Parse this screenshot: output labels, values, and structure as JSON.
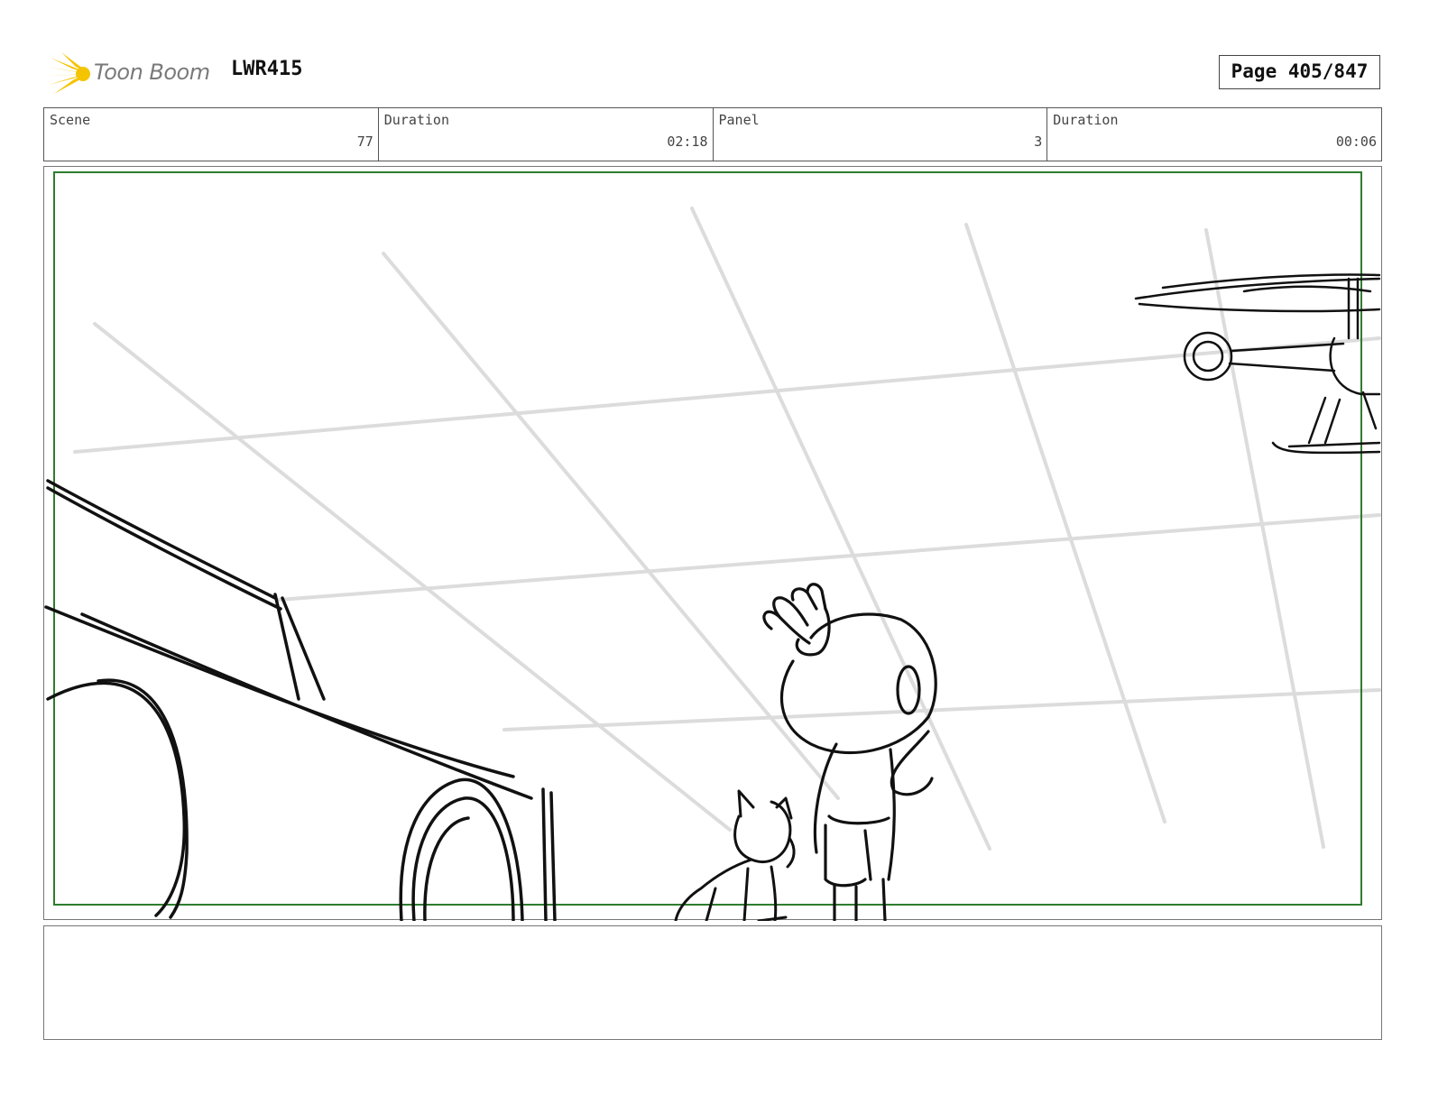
{
  "header": {
    "logo_text": "Toon Boom",
    "project_code": "LWR415",
    "page_label": "Page 405/847"
  },
  "info": {
    "scene_label": "Scene",
    "scene_value": "77",
    "scene_duration_label": "Duration",
    "scene_duration_value": "02:18",
    "panel_label": "Panel",
    "panel_value": "3",
    "panel_duration_label": "Duration",
    "panel_duration_value": "00:06"
  },
  "notes": {
    "text": ""
  },
  "colors": {
    "safe_frame": "#2e7d2e",
    "logo_yellow": "#f5c400",
    "sketch_line": "#111111",
    "grid_line": "#dddddd"
  }
}
